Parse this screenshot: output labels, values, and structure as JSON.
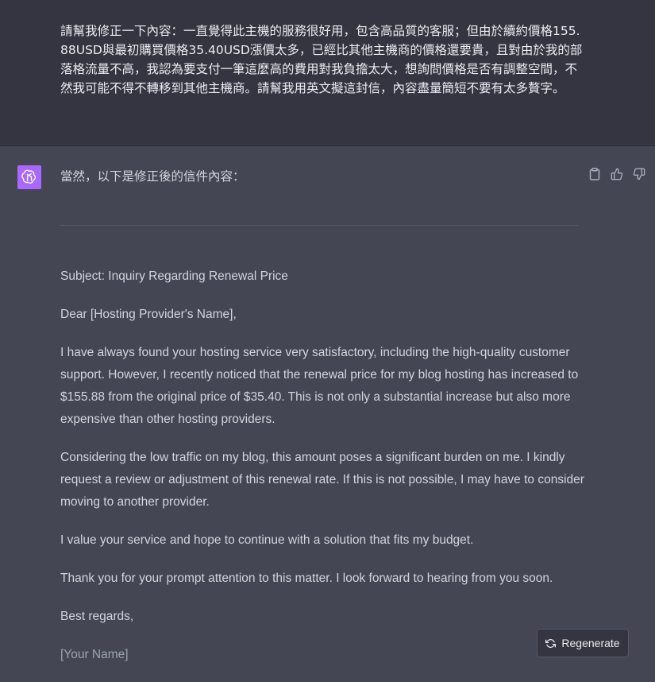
{
  "user_message": {
    "text": "請幫我修正一下內容：一直覺得此主機的服務很好用，包含高品質的客服；但由於續約價格155.88USD與最初購買價格35.40USD漲價太多，已經比其他主機商的價格還要貴，且對由於我的部落格流量不高，我認為要支付一筆這麼高的費用對我負擔太大，想詢問價格是否有調整空間，不然我可能不得不轉移到其他主機商。請幫我用英文擬這封信，內容盡量簡短不要有太多贅字。"
  },
  "assistant_message": {
    "avatar_icon": "openai-logo-icon",
    "avatar_color": "#ab68ff",
    "intro": "當然，以下是修正後的信件內容：",
    "letter": {
      "subject": "Subject: Inquiry Regarding Renewal Price",
      "greeting": "Dear [Hosting Provider's Name],",
      "paragraph1": "I have always found your hosting service very satisfactory, including the high-quality customer support. However, I recently noticed that the renewal price for my blog hosting has increased to $155.88 from the original price of $35.40. This is not only a substantial increase but also more expensive than other hosting providers.",
      "paragraph2": "Considering the low traffic on my blog, this amount poses a significant burden on me. I kindly request a review or adjustment of this renewal rate. If this is not possible, I may have to consider moving to another provider.",
      "paragraph3": "I value your service and hope to continue with a solution that fits my budget.",
      "paragraph4": "Thank you for your prompt attention to this matter. I look forward to hearing from you soon.",
      "closing": "Best regards,",
      "signature": "[Your Name]"
    },
    "actions": [
      "copy-icon",
      "thumbs-up-icon",
      "thumbs-down-icon"
    ]
  },
  "regenerate_button": {
    "label": "Regenerate",
    "icon": "refresh-icon"
  },
  "colors": {
    "user_bg": "#343541",
    "assistant_bg": "#444654"
  }
}
